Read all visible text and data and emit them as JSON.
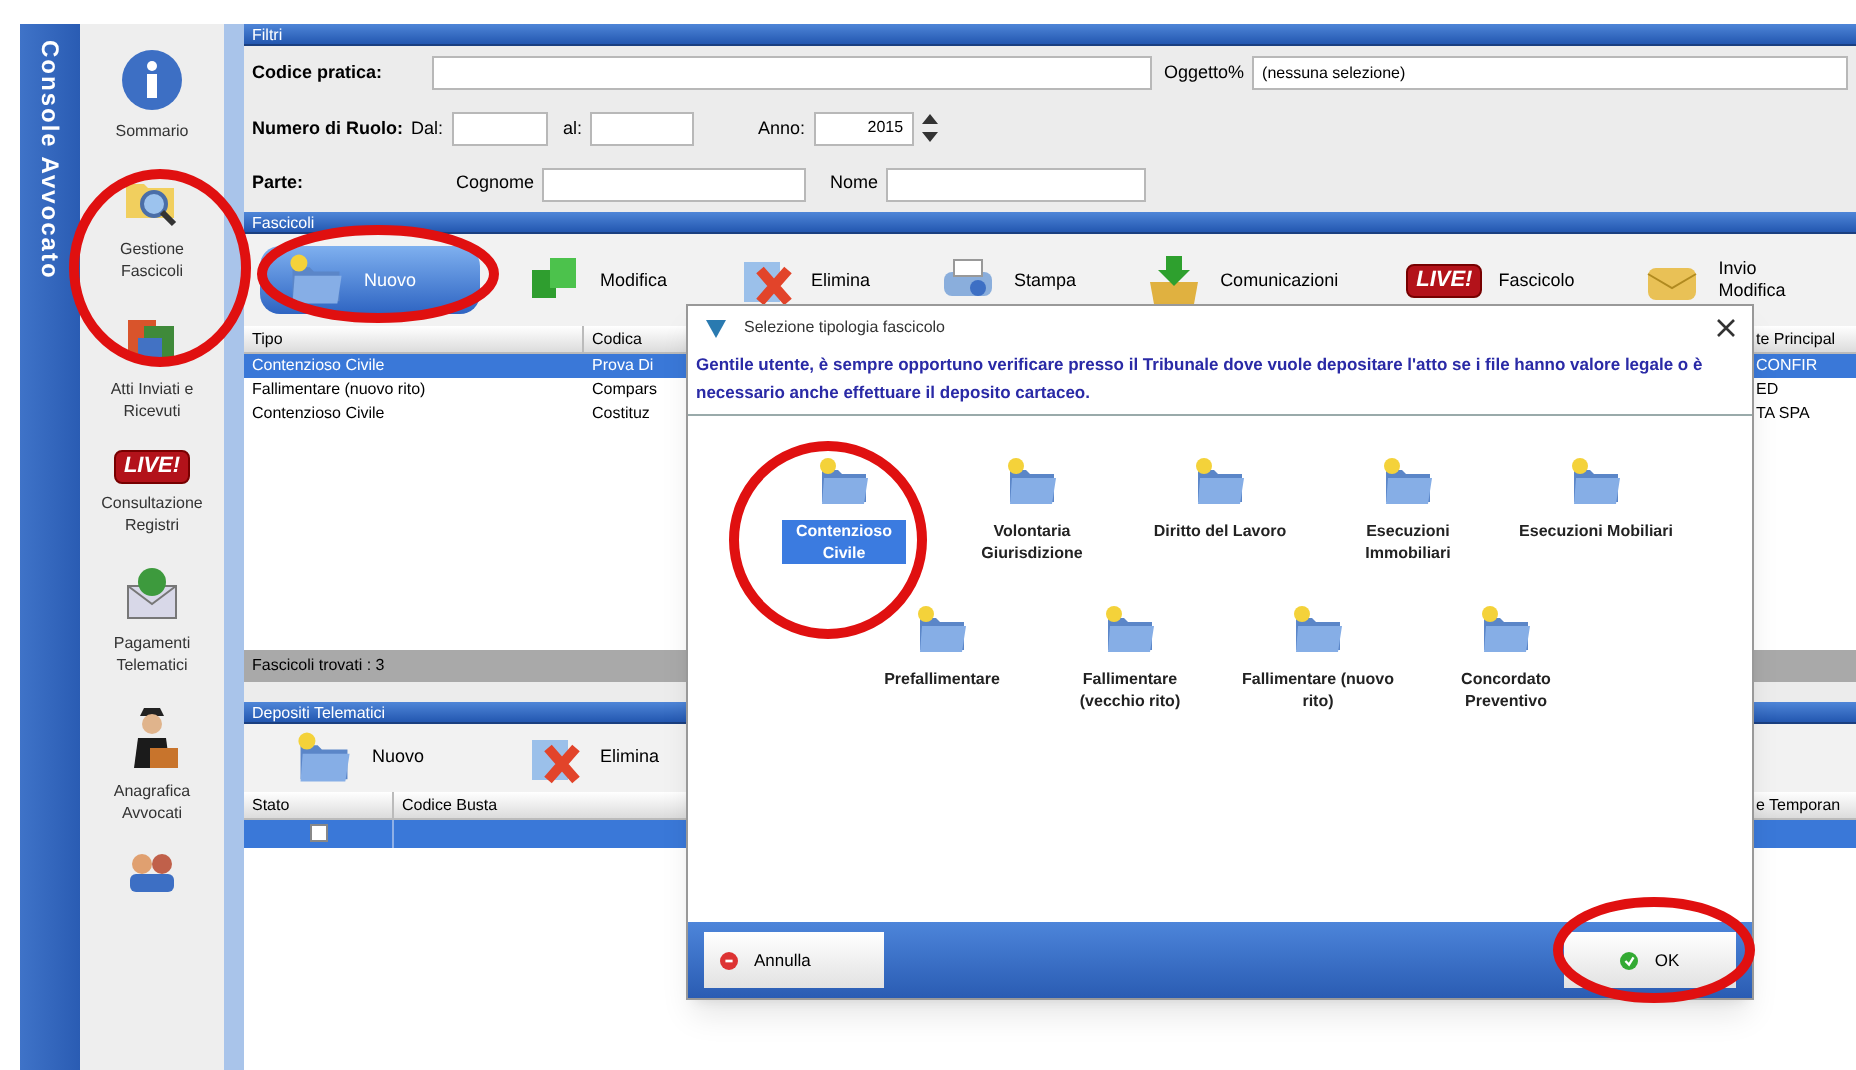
{
  "app_title": "Console Avvocato",
  "sidebar": {
    "items": [
      {
        "label": "Sommario"
      },
      {
        "label": "Gestione Fascicoli"
      },
      {
        "label": "Atti Inviati e Ricevuti"
      },
      {
        "label": "Consultazione Registri",
        "badge": "LIVE!"
      },
      {
        "label": "Pagamenti Telematici"
      },
      {
        "label": "Anagrafica Avvocati"
      }
    ]
  },
  "filters": {
    "title": "Filtri",
    "codice_pratica": {
      "label": "Codice pratica:"
    },
    "oggetto": {
      "label": "Oggetto%",
      "value": "(nessuna selezione)"
    },
    "numero_ruolo": {
      "label": "Numero di Ruolo:",
      "from_label": "Dal:",
      "to_label": "al:",
      "year_label": "Anno:",
      "year": "2015"
    },
    "parte": {
      "label": "Parte:",
      "surname_label": "Cognome",
      "name_label": "Nome"
    }
  },
  "fascicoli": {
    "title": "Fascicoli",
    "toolbar": [
      {
        "label": "Nuovo",
        "selected": true
      },
      {
        "label": "Modifica",
        "selected": false
      },
      {
        "label": "Elimina",
        "selected": false
      },
      {
        "label": "Stampa",
        "selected": false
      },
      {
        "label": "Comunicazioni",
        "selected": false
      },
      {
        "label": "Fascicolo",
        "selected": false,
        "badge": "LIVE!"
      },
      {
        "label": "Invio Modifica",
        "selected": false
      }
    ],
    "columns": [
      "Tipo",
      "Codica",
      "te Principal"
    ],
    "rows": [
      {
        "cells": [
          "Contenzioso Civile",
          "Prova Di",
          "CONFIR"
        ],
        "selected": true
      },
      {
        "cells": [
          "Fallimentare (nuovo rito)",
          "Compars",
          "ED"
        ],
        "selected": false
      },
      {
        "cells": [
          "Contenzioso Civile",
          "Costituz",
          "TA SPA"
        ],
        "selected": false
      }
    ],
    "status": "Fascicoli trovati : 3"
  },
  "depositi": {
    "title": "Depositi Telematici",
    "toolbar": [
      {
        "label": "Nuovo"
      },
      {
        "label": "Elimina"
      }
    ],
    "columns": [
      "Stato",
      "Codice Busta",
      "e Temporan"
    ],
    "rows": [
      {
        "checked": false,
        "selected": true
      }
    ]
  },
  "dialog": {
    "title": "Selezione tipologia fascicolo",
    "message": "Gentile utente, è sempre opportuno verificare presso il Tribunale dove vuole depositare l'atto se i file hanno valore legale o è necessario anche effettuare il deposito cartaceo.",
    "rows": [
      {
        "items": [
          {
            "label": "Contenzioso Civile",
            "selected": true
          },
          {
            "label": "Volontaria Giurisdizione",
            "selected": false
          },
          {
            "label": "Diritto del Lavoro",
            "selected": false
          },
          {
            "label": "Esecuzioni Immobiliari",
            "selected": false
          },
          {
            "label": "Esecuzioni Mobiliari",
            "selected": false
          }
        ]
      },
      {
        "items": [
          {
            "label": "Prefallimentare",
            "selected": false
          },
          {
            "label": "Fallimentare (vecchio rito)",
            "selected": false
          },
          {
            "label": "Fallimentare (nuovo rito)",
            "selected": false
          },
          {
            "label": "Concordato Preventivo",
            "selected": false
          }
        ]
      }
    ],
    "cancel": "Annulla",
    "ok": "OK"
  }
}
